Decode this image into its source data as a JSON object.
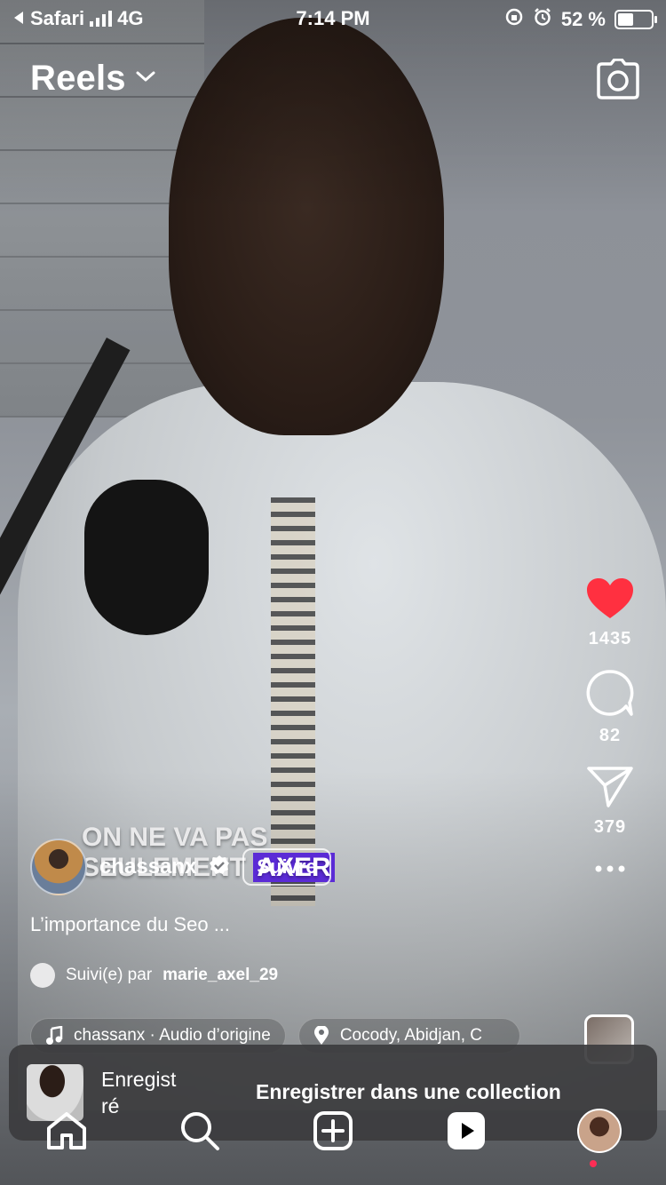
{
  "status_bar": {
    "back_app": "Safari",
    "network": "4G",
    "time": "7:14 PM",
    "battery_text": "52 %",
    "battery_level": 0.52
  },
  "header": {
    "title": "Reels"
  },
  "actions": {
    "likes": "1435",
    "comments": "82",
    "shares": "379",
    "like_color": "#ff3040"
  },
  "video_overlay": {
    "line1": "ON NE VA PAS",
    "line2a": "SEULEMENT",
    "line2b": "AXER"
  },
  "post": {
    "username": "chassanx",
    "follow_label": "Suivre",
    "caption": "L’importance du Seo ...",
    "followed_by_prefix": "Suivi(e) par",
    "followed_by_user": "marie_axel_29",
    "audio": "chassanx · Audio d’origine",
    "location": "Cocody, Abidjan, C"
  },
  "toast": {
    "saved_label": "Enregistré",
    "saved_line1": "Enregist",
    "saved_line2": "ré",
    "collection_label": "Enregistrer dans une collection"
  },
  "icons": {
    "back": "back-triangle-icon",
    "camera": "camera-icon",
    "heart": "heart-icon",
    "comment": "comment-icon",
    "share": "paper-plane-icon",
    "more": "more-dots-icon",
    "music": "music-note-icon",
    "location": "location-pin-icon",
    "verified": "verified-badge-icon"
  }
}
